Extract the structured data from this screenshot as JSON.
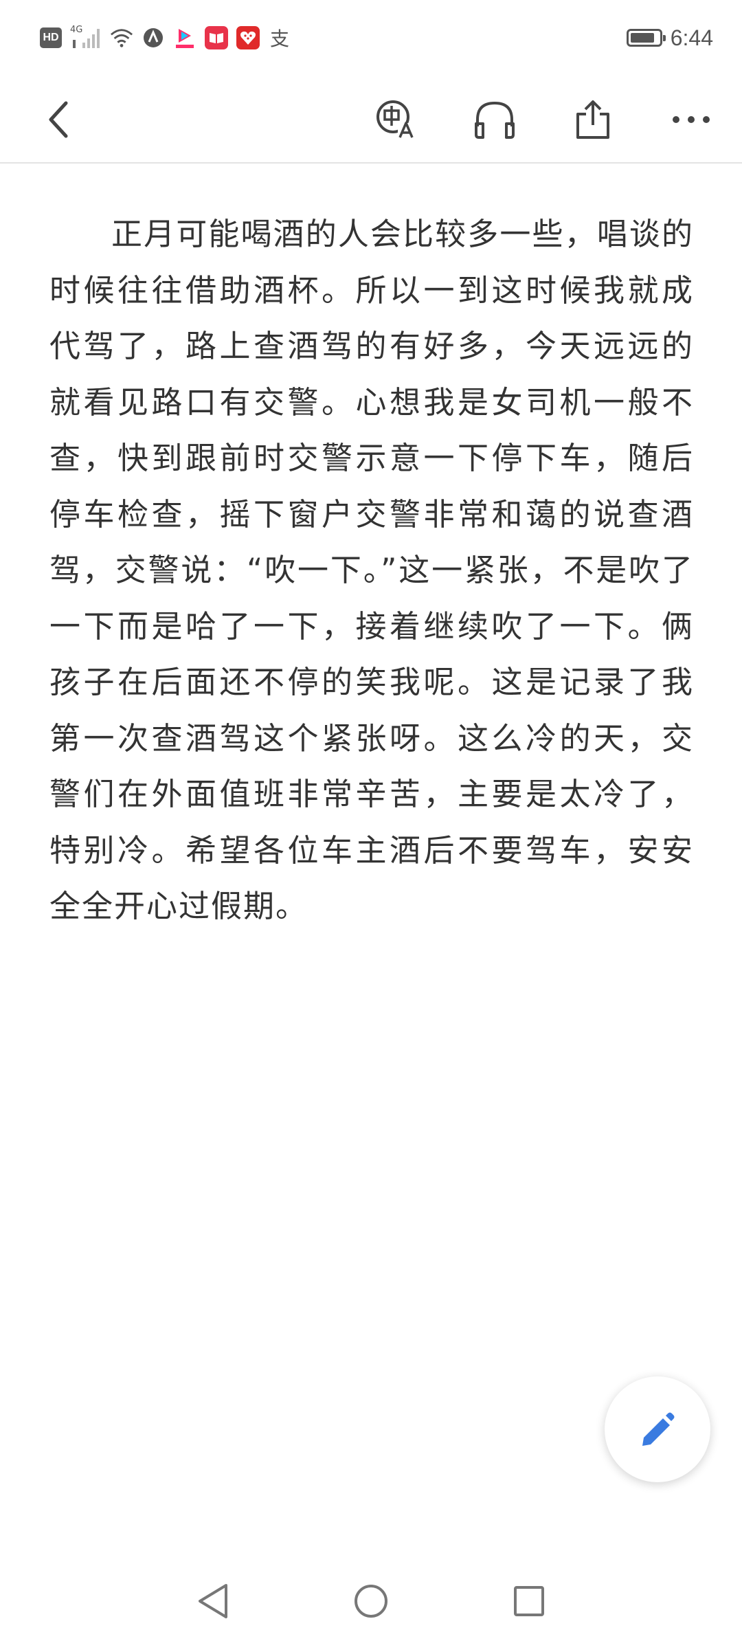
{
  "status_bar": {
    "hd_label": "HD",
    "network_label": "4G",
    "time": "6:44",
    "battery_level": 0.85,
    "app_icons": [
      "wifi-icon",
      "nfc-icon",
      "youku-icon",
      "reader-icon",
      "heart-app-icon",
      "alipay-icon"
    ],
    "alipay_char": "支"
  },
  "toolbar": {
    "icons": [
      "back-icon",
      "translate-icon",
      "headphones-icon",
      "share-icon",
      "more-icon"
    ]
  },
  "article": {
    "text": "正月可能喝酒的人会比较多一些，唱谈的时候往往借助酒杯。所以一到这时候我就成代驾了，路上查酒驾的有好多，今天远远的就看见路口有交警。心想我是女司机一般不查，快到跟前时交警示意一下停下车，随后停车检查，摇下窗户交警非常和蔼的说查酒驾，交警说：“吹一下。”这一紧张，不是吹了一下而是哈了一下，接着继续吹了一下。俩孩子在后面还不停的笑我呢。这是记录了我第一次查酒驾这个紧张呀。这么冷的天，交警们在外面值班非常辛苦，主要是太冷了，特别冷。希望各位车主酒后不要驾车，安安全全开心过假期。"
  },
  "fab": {
    "icon": "pencil-icon",
    "color": "#3a7be0"
  },
  "nav_bar": {
    "icons": [
      "nav-back-icon",
      "nav-home-icon",
      "nav-recents-icon"
    ]
  }
}
